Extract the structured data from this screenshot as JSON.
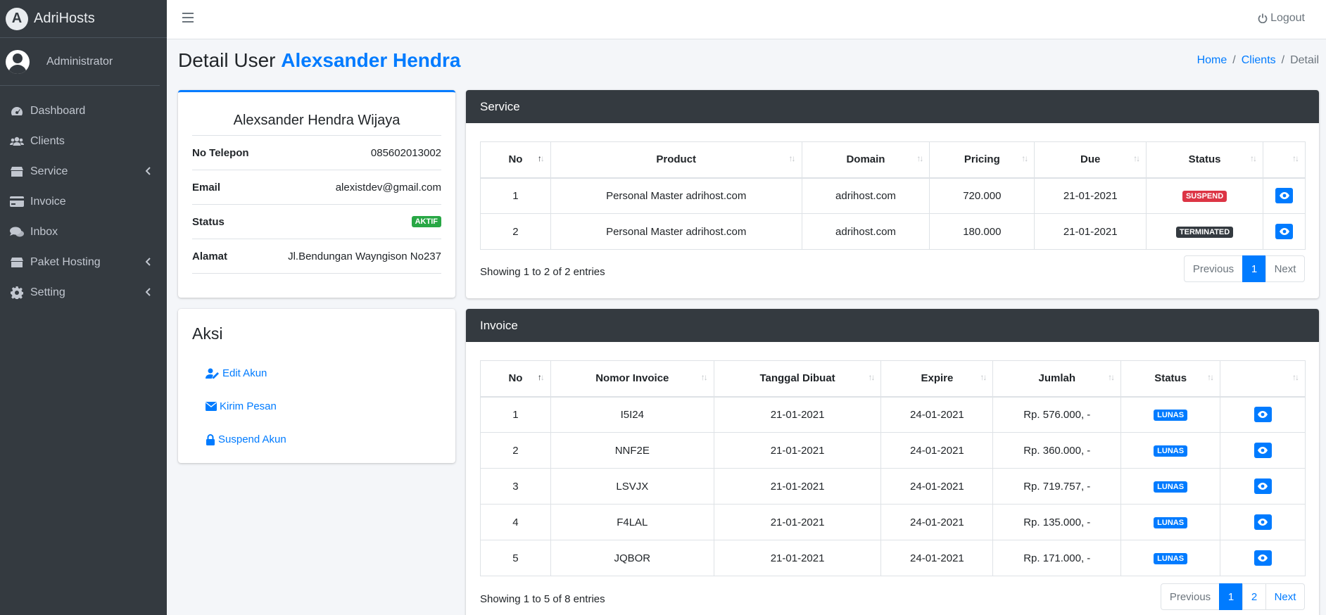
{
  "brand": {
    "name": "AdriHosts",
    "logo_letter": "A"
  },
  "user": {
    "name": "Administrator"
  },
  "nav": [
    {
      "label": "Dashboard",
      "icon": "dashboard-icon",
      "chevron": false
    },
    {
      "label": "Clients",
      "icon": "users-icon",
      "chevron": false
    },
    {
      "label": "Service",
      "icon": "box-icon",
      "chevron": true
    },
    {
      "label": "Invoice",
      "icon": "credit-card-icon",
      "chevron": false
    },
    {
      "label": "Inbox",
      "icon": "comments-icon",
      "chevron": false
    },
    {
      "label": "Paket Hosting",
      "icon": "box-icon",
      "chevron": true
    },
    {
      "label": "Setting",
      "icon": "gear-icon",
      "chevron": true
    }
  ],
  "topbar": {
    "logout": "Logout"
  },
  "page": {
    "title_prefix": "Detail User",
    "title_name": "Alexsander Hendra"
  },
  "breadcrumb": {
    "home": "Home",
    "clients": "Clients",
    "current": "Detail"
  },
  "profile": {
    "full_name": "Alexsander Hendra Wijaya",
    "phone_label": "No Telepon",
    "phone": "085602013002",
    "email_label": "Email",
    "email": "alexistdev@gmail.com",
    "status_label": "Status",
    "status": "AKTIF",
    "address_label": "Alamat",
    "address": "Jl.Bendungan Wayngison No237"
  },
  "aksi": {
    "title": "Aksi",
    "edit": "Edit Akun",
    "message": "Kirim Pesan",
    "suspend": "Suspend Akun"
  },
  "service": {
    "title": "Service",
    "headers": [
      "No",
      "Product",
      "Domain",
      "Pricing",
      "Due",
      "Status",
      ""
    ],
    "rows": [
      {
        "no": "1",
        "product": "Personal Master adrihost.com",
        "domain": "adrihost.com",
        "pricing": "720.000",
        "due": "21-01-2021",
        "status": "SUSPEND"
      },
      {
        "no": "2",
        "product": "Personal Master adrihost.com",
        "domain": "adrihost.com",
        "pricing": "180.000",
        "due": "21-01-2021",
        "status": "TERMINATED"
      }
    ],
    "info": "Showing 1 to 2 of 2 entries",
    "pager": {
      "prev": "Previous",
      "pages": [
        "1"
      ],
      "next": "Next"
    }
  },
  "invoice": {
    "title": "Invoice",
    "headers": [
      "No",
      "Nomor Invoice",
      "Tanggal Dibuat",
      "Expire",
      "Jumlah",
      "Status",
      ""
    ],
    "rows": [
      {
        "no": "1",
        "number": "I5I24",
        "created": "21-01-2021",
        "expire": "24-01-2021",
        "amount": "Rp. 576.000, -",
        "status": "LUNAS"
      },
      {
        "no": "2",
        "number": "NNF2E",
        "created": "21-01-2021",
        "expire": "24-01-2021",
        "amount": "Rp. 360.000, -",
        "status": "LUNAS"
      },
      {
        "no": "3",
        "number": "LSVJX",
        "created": "21-01-2021",
        "expire": "24-01-2021",
        "amount": "Rp. 719.757, -",
        "status": "LUNAS"
      },
      {
        "no": "4",
        "number": "F4LAL",
        "created": "21-01-2021",
        "expire": "24-01-2021",
        "amount": "Rp. 135.000, -",
        "status": "LUNAS"
      },
      {
        "no": "5",
        "number": "JQBOR",
        "created": "21-01-2021",
        "expire": "24-01-2021",
        "amount": "Rp. 171.000, -",
        "status": "LUNAS"
      }
    ],
    "info": "Showing 1 to 5 of 8 entries",
    "pager": {
      "prev": "Previous",
      "pages": [
        "1",
        "2"
      ],
      "next": "Next"
    }
  },
  "colors": {
    "sidebar": "#343a40",
    "accent": "#007bff",
    "success": "#28a745",
    "danger": "#dc3545"
  }
}
